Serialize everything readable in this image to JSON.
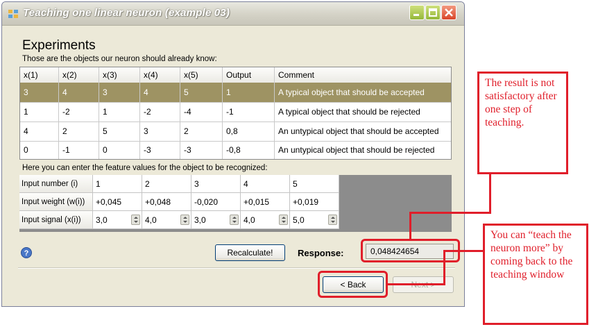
{
  "window": {
    "title": "Teaching one linear neuron (example 03)"
  },
  "experiments": {
    "heading": "Experiments",
    "subheading": "Those are the objects our neuron should already know:",
    "columns": [
      "x(1)",
      "x(2)",
      "x(3)",
      "x(4)",
      "x(5)",
      "Output",
      "Comment"
    ],
    "rows": [
      [
        "3",
        "4",
        "3",
        "4",
        "5",
        "1",
        "A typical object that should be accepted"
      ],
      [
        "1",
        "-2",
        "1",
        "-2",
        "-4",
        "-1",
        "A typical object that should be rejected"
      ],
      [
        "4",
        "2",
        "5",
        "3",
        "2",
        "0,8",
        "An untypical object that should be accepted"
      ],
      [
        "0",
        "-1",
        "0",
        "-3",
        "-3",
        "-0,8",
        "An untypical object that should be rejected"
      ]
    ],
    "selected_row": 0
  },
  "recognition": {
    "label": "Here you can enter the feature values for the object to be recognized:",
    "row_labels": [
      "Input number (i)",
      "Input weight (w(i))",
      "Input signal (x(i))"
    ],
    "input_numbers": [
      "1",
      "2",
      "3",
      "4",
      "5"
    ],
    "weights": [
      "+0,045",
      "+0,048",
      "-0,020",
      "+0,015",
      "+0,019"
    ],
    "signals": [
      "3,0",
      "4,0",
      "3,0",
      "4,0",
      "5,0"
    ]
  },
  "footer": {
    "recalculate_label": "Recalculate!",
    "response_label": "Response:",
    "response_value": "0,048424654",
    "back_label": "< Back",
    "next_label": "Next >"
  },
  "annotations": {
    "callout_result": "The result is not satisfactory after one step of teaching.",
    "callout_teach": "You can “teach the neuron more” by coming back to the teaching window",
    "color": "#e01e2a"
  },
  "colors": {
    "selected_row": "#9e9363",
    "window_bg": "#ece9d8"
  },
  "icons": [
    "app-icon",
    "minimize-icon",
    "maximize-icon",
    "close-icon",
    "help-icon",
    "spin-up-down-icon"
  ]
}
